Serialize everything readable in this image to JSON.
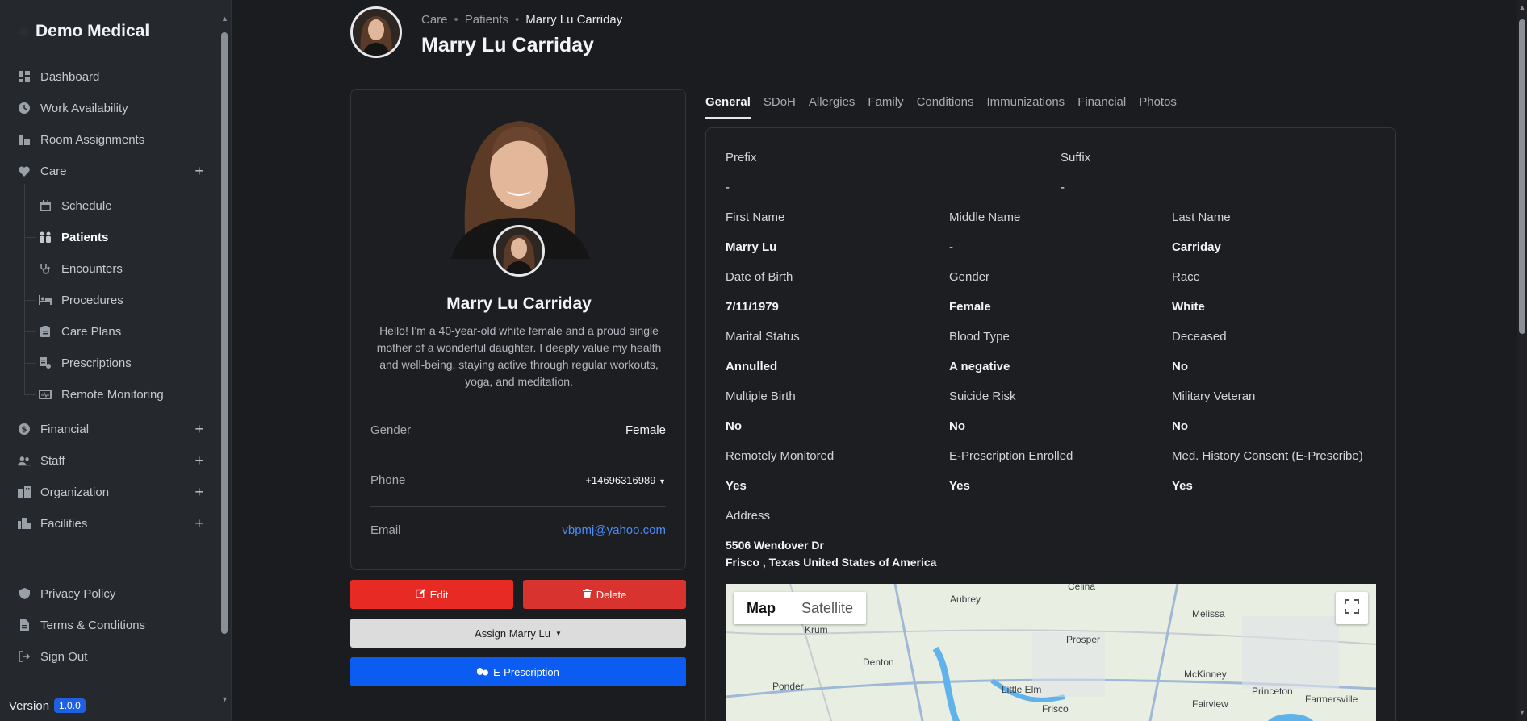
{
  "sidebar": {
    "brand": "Demo Medical",
    "items": [
      {
        "label": "Dashboard",
        "icon": "dashboard-icon"
      },
      {
        "label": "Work Availability",
        "icon": "clock-icon"
      },
      {
        "label": "Room Assignments",
        "icon": "building-icon"
      },
      {
        "label": "Care",
        "icon": "heart-icon"
      }
    ],
    "care_sub": [
      {
        "label": "Schedule"
      },
      {
        "label": "Patients"
      },
      {
        "label": "Encounters"
      },
      {
        "label": "Procedures"
      },
      {
        "label": "Care Plans"
      },
      {
        "label": "Prescriptions"
      },
      {
        "label": "Remote Monitoring"
      }
    ],
    "groups": [
      {
        "label": "Financial"
      },
      {
        "label": "Staff"
      },
      {
        "label": "Organization"
      },
      {
        "label": "Facilities"
      }
    ],
    "footer": [
      {
        "label": "Privacy Policy"
      },
      {
        "label": "Terms & Conditions"
      },
      {
        "label": "Sign Out"
      }
    ],
    "version_label": "Version",
    "version": "1.0.0"
  },
  "header": {
    "breadcrumb": [
      "Care",
      "Patients",
      "Marry Lu Carriday"
    ],
    "title": "Marry Lu Carriday"
  },
  "profile": {
    "name": "Marry Lu Carriday",
    "bio": "Hello! I'm a 40-year-old white female and a proud single mother of a wonderful daughter. I deeply value my health and well-being, staying active through regular workouts, yoga, and meditation.",
    "gender_label": "Gender",
    "gender": "Female",
    "phone_label": "Phone",
    "phone": "+14696316989",
    "email_label": "Email",
    "email": "vbpmj@yahoo.com"
  },
  "actions": {
    "edit": "Edit",
    "delete": "Delete",
    "assign": "Assign Marry Lu",
    "eprescription": "E-Prescription"
  },
  "tabs": [
    "General",
    "SDoH",
    "Allergies",
    "Family",
    "Conditions",
    "Immunizations",
    "Financial",
    "Photos"
  ],
  "general": {
    "prefix_label": "Prefix",
    "prefix": "-",
    "suffix_label": "Suffix",
    "suffix": "-",
    "first_label": "First Name",
    "first": "Marry Lu",
    "middle_label": "Middle Name",
    "middle": "-",
    "last_label": "Last Name",
    "last": "Carriday",
    "dob_label": "Date of Birth",
    "dob": "7/11/1979",
    "gender_label": "Gender",
    "gender": "Female",
    "race_label": "Race",
    "race": "White",
    "marital_label": "Marital Status",
    "marital": "Annulled",
    "blood_label": "Blood Type",
    "blood": "A negative",
    "deceased_label": "Deceased",
    "deceased": "No",
    "multibirth_label": "Multiple Birth",
    "multibirth": "No",
    "suicide_label": "Suicide Risk",
    "suicide": "No",
    "veteran_label": "Military Veteran",
    "veteran": "No",
    "remote_label": "Remotely Monitored",
    "remote": "Yes",
    "erx_label": "E-Prescription Enrolled",
    "erx": "Yes",
    "consent_label": "Med. History Consent (E-Prescribe)",
    "consent": "Yes",
    "address_label": "Address",
    "address1": "5506 Wendover Dr",
    "address2": "Frisco , Texas United States of America"
  },
  "map": {
    "map_btn": "Map",
    "satellite_btn": "Satellite",
    "places": [
      "Aubrey",
      "Celina",
      "Melissa",
      "Krum",
      "Denton",
      "Prosper",
      "McKinney",
      "Ponder",
      "Little Elm",
      "Princeton",
      "Fairview",
      "Farmersville",
      "Frisco"
    ]
  }
}
